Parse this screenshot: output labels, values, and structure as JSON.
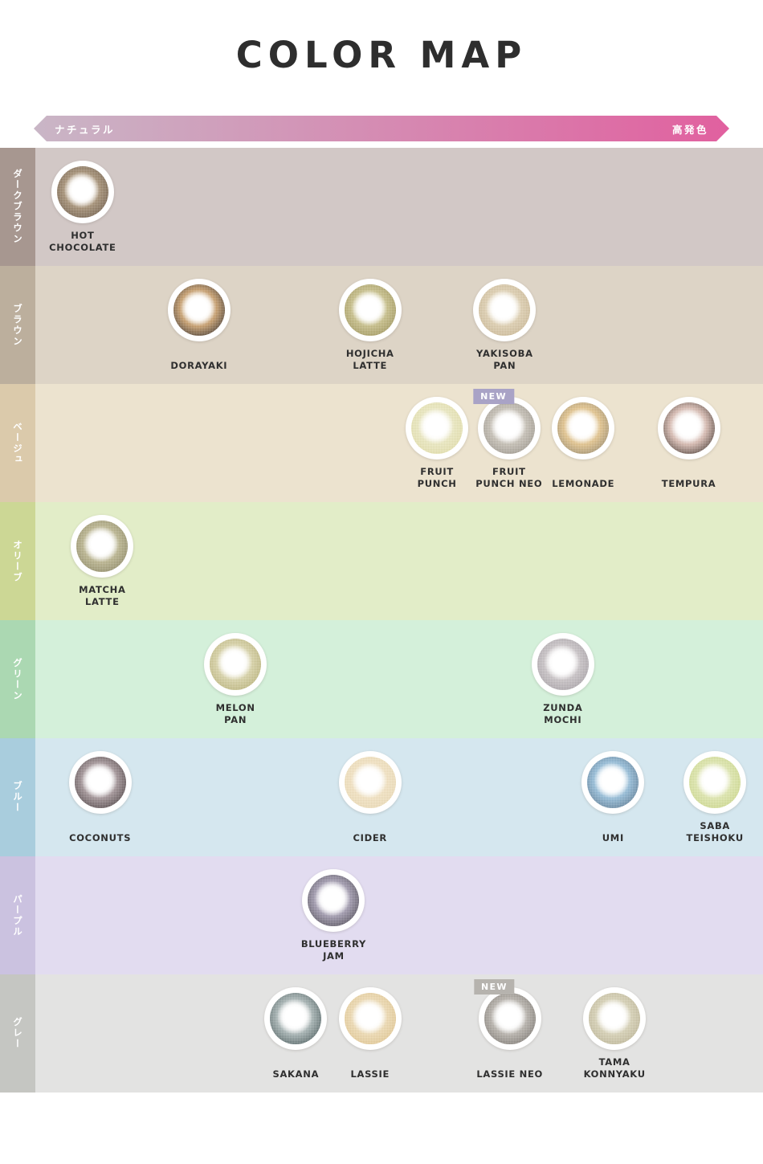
{
  "header": {
    "title": "COLOR MAP"
  },
  "scale": {
    "left_label": "ナチュラル",
    "right_label": "高発色",
    "gradient_from": "#c9b6c6",
    "gradient_to": "#e1609f"
  },
  "badge_label": "NEW",
  "rows": [
    {
      "label": "ダークブラウン",
      "label_bg": "#a79790",
      "track_bg": "#d2c8c6",
      "items": [
        {
          "name": "HOT\nCHOCOLATE",
          "x_pct": 6.5,
          "ring": "#6e5b48",
          "mid": "#a08a6e",
          "inner": "#e6d9c5",
          "new": false
        }
      ]
    },
    {
      "label": "ブラウン",
      "label_bg": "#bcaf9d",
      "track_bg": "#ddd4c6",
      "items": [
        {
          "name": "DORAYAKI",
          "x_pct": 22.5,
          "ring": "#3f342c",
          "mid": "#c59a66",
          "inner": "#f2e6d2",
          "new": false
        },
        {
          "name": "HOJICHA\nLATTE",
          "x_pct": 46.0,
          "ring": "#9e9459",
          "mid": "#c4bb82",
          "inner": "#efeccf",
          "new": false
        },
        {
          "name": "YAKISOBA\nPAN",
          "x_pct": 64.5,
          "ring": "#cbb894",
          "mid": "#ddcdad",
          "inner": "#f6eeda",
          "new": false
        }
      ]
    },
    {
      "label": "ベージュ",
      "label_bg": "#dbcaab",
      "track_bg": "#ece3cf",
      "items": [
        {
          "name": "FRUIT\nPUNCH",
          "x_pct": 55.2,
          "ring": "#e3dfa8",
          "mid": "#ebe8bd",
          "inner": "#faf8e4",
          "new": false
        },
        {
          "name": "FRUIT\nPUNCH NEO",
          "x_pct": 65.1,
          "ring": "#9b958b",
          "mid": "#c3bdb2",
          "inner": "#f3efe9",
          "new": true
        },
        {
          "name": "LEMONADE",
          "x_pct": 75.3,
          "ring": "#9b8b6b",
          "mid": "#e2c289",
          "inner": "#faf0d8",
          "new": false
        },
        {
          "name": "TEMPURA",
          "x_pct": 89.8,
          "ring": "#4b3c35",
          "mid": "#d6b8ae",
          "inner": "#f8eeea",
          "new": false
        }
      ]
    },
    {
      "label": "オリーブ",
      "label_bg": "#ccd795",
      "track_bg": "#e2edc8",
      "items": [
        {
          "name": "MATCHA\nLATTE",
          "x_pct": 9.2,
          "ring": "#8c8763",
          "mid": "#b7b189",
          "inner": "#eceadb",
          "new": false
        }
      ]
    },
    {
      "label": "グリーン",
      "label_bg": "#abd8b2",
      "track_bg": "#d4f0da",
      "items": [
        {
          "name": "MELON\nPAN",
          "x_pct": 27.5,
          "ring": "#b9b277",
          "mid": "#d6d0a2",
          "inner": "#f5f2dc",
          "new": false
        },
        {
          "name": "ZUNDA\nMOCHI",
          "x_pct": 72.5,
          "ring": "#a6a0a5",
          "mid": "#c6c0c3",
          "inner": "#f2eeee",
          "new": false
        }
      ]
    },
    {
      "label": "ブルー",
      "label_bg": "#a9cddd",
      "track_bg": "#d5e7ef",
      "items": [
        {
          "name": "COCONUTS",
          "x_pct": 8.9,
          "ring": "#4b4042",
          "mid": "#9b8c8f",
          "inner": "#efe9ea",
          "new": false
        },
        {
          "name": "CIDER",
          "x_pct": 46.0,
          "ring": "#eddcb6",
          "mid": "#f3e2bf",
          "inner": "#fdf7e8",
          "new": false
        },
        {
          "name": "UMI",
          "x_pct": 79.4,
          "ring": "#5b7a93",
          "mid": "#8fb9d6",
          "inner": "#e4f2fb",
          "new": false
        },
        {
          "name": "SABA\nTEISHOKU",
          "x_pct": 93.4,
          "ring": "#cdd98a",
          "mid": "#dde6a9",
          "inner": "#f7f8de",
          "new": false
        }
      ]
    },
    {
      "label": "パープル",
      "label_bg": "#cbc2e0",
      "track_bg": "#e2dcf0",
      "items": [
        {
          "name": "BLUEBERRY\nJAM",
          "x_pct": 41.0,
          "ring": "#4e4a55",
          "mid": "#9a93a8",
          "inner": "#ece9f2",
          "new": false
        }
      ]
    },
    {
      "label": "グレー",
      "label_bg": "#c5c6c2",
      "track_bg": "#e3e3e2",
      "items": [
        {
          "name": "SAKANA",
          "x_pct": 35.8,
          "ring": "#4a5b5c",
          "mid": "#9fadad",
          "inner": "#f0f2f1",
          "new": false
        },
        {
          "name": "LASSIE",
          "x_pct": 46.0,
          "ring": "#e2c68f",
          "mid": "#eed9ae",
          "inner": "#fbf4e2",
          "new": false
        },
        {
          "name": "LASSIE NEO",
          "x_pct": 65.2,
          "ring": "#7b7670",
          "mid": "#b2ada6",
          "inner": "#f0eeea",
          "new": true
        },
        {
          "name": "TAMA\nKONNYAKU",
          "x_pct": 79.6,
          "ring": "#bdb595",
          "mid": "#d5cfb2",
          "inner": "#f6f3e5",
          "new": false
        }
      ]
    }
  ]
}
